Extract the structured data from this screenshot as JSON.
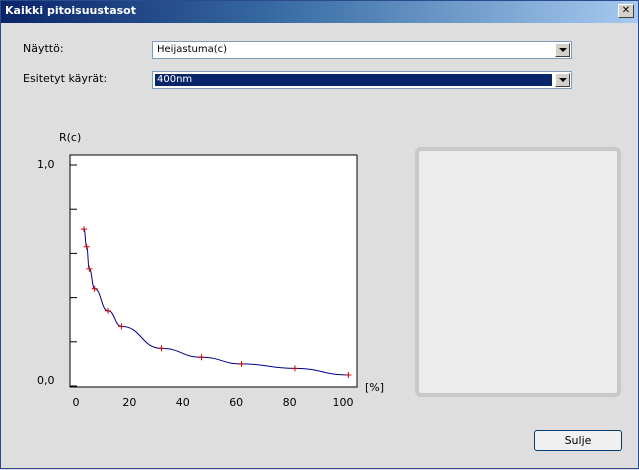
{
  "window": {
    "title": "Kaikki pitoisuustasot",
    "close_glyph": "✕"
  },
  "display": {
    "label": "Näyttö:",
    "value": "Heijastuma(c)"
  },
  "curves": {
    "label": "Esitetyt käyrät:",
    "value": "400nm"
  },
  "chart_data": {
    "type": "line",
    "ylabel": "R(c)",
    "xlabel": "[%]",
    "ylim": [
      0,
      1.0
    ],
    "xlim": [
      0,
      104
    ],
    "x_ticks": [
      0,
      20,
      40,
      60,
      80,
      100
    ],
    "y_tick_labels": [
      "1,0",
      "0,0"
    ],
    "y_ticks": [
      0,
      0.2,
      0.4,
      0.6,
      0.8,
      1.0
    ],
    "line_color": "#00008b",
    "marker_color": "#cc0000",
    "series": [
      {
        "x": [
          3,
          4,
          5,
          7,
          12,
          17,
          32,
          47,
          62,
          82,
          102
        ],
        "y": [
          0.71,
          0.63,
          0.53,
          0.44,
          0.34,
          0.27,
          0.17,
          0.13,
          0.1,
          0.08,
          0.05
        ]
      }
    ]
  },
  "buttons": {
    "close": "Sulje"
  }
}
